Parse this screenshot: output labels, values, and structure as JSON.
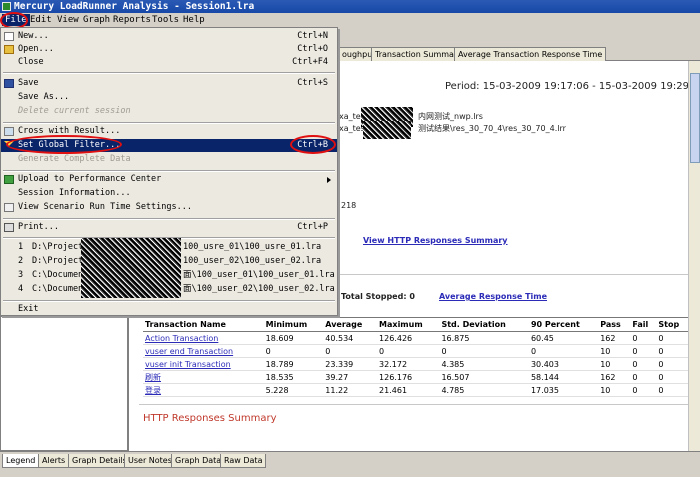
{
  "window": {
    "title": "Mercury LoadRunner Analysis - Session1.lra"
  },
  "menubar": [
    "File",
    "Edit",
    "View",
    "Graph",
    "Reports",
    "Tools",
    "Help"
  ],
  "file_menu": {
    "new": {
      "label": "New...",
      "key": "Ctrl+N"
    },
    "open": {
      "label": "Open...",
      "key": "Ctrl+O"
    },
    "close": {
      "label": "Close",
      "key": "Ctrl+F4"
    },
    "save": {
      "label": "Save",
      "key": "Ctrl+S"
    },
    "save_as": {
      "label": "Save As..."
    },
    "delete_session": {
      "label": "Delete current session"
    },
    "cross_result": {
      "label": "Cross with Result..."
    },
    "set_global_filter": {
      "label": "Set Global Filter...",
      "key": "Ctrl+B"
    },
    "generate_complete_data": {
      "label": "Generate Complete Data"
    },
    "upload": {
      "label": "Upload to Performance Center"
    },
    "session_info": {
      "label": "Session Information..."
    },
    "view_scenario": {
      "label": "View Scenario Run Time Settings..."
    },
    "print": {
      "label": "Print...",
      "key": "Ctrl+P"
    },
    "recent": [
      {
        "n": "1",
        "left": "D:\\Project",
        "right": "100_usre_01\\100_usre_01.lra"
      },
      {
        "n": "2",
        "left": "D:\\Project",
        "right": "100_user_02\\100_user_02.lra"
      },
      {
        "n": "3",
        "left": "C:\\Documents and Settings",
        "right": "面\\100_user_01\\100_user_01.lra"
      },
      {
        "n": "4",
        "left": "C:\\Documents and Settings",
        "right": "面\\100_user_02\\100_user_02.lra"
      }
    ],
    "exit": {
      "label": "Exit"
    }
  },
  "tabs": [
    "oughput",
    "Transaction Summary",
    "Average Transaction Response Time"
  ],
  "summary": {
    "period": "Period: 15-03-2009 19:17:06 - 15-03-2009 19:29:21",
    "file1": "xa_test",
    "file1_tail": "内网测试_nwp.lrs",
    "file2": "xa_test",
    "file2_tail": "测试结果\\res_30_70_4\\res_30_70_4.lrr",
    "number": "218",
    "http_link": "View HTTP Responses Summary",
    "total_stopped": "Total Stopped: 0",
    "avg_link": "Average Response Time",
    "http_section": "HTTP Responses Summary"
  },
  "table": {
    "headers": [
      "Transaction Name",
      "Minimum",
      "Average",
      "Maximum",
      "Std. Deviation",
      "90 Percent",
      "Pass",
      "Fail",
      "Stop"
    ],
    "rows": [
      [
        "Action Transaction",
        "18.609",
        "40.534",
        "126.426",
        "16.875",
        "60.45",
        "162",
        "0",
        "0"
      ],
      [
        "vuser end Transaction",
        "0",
        "0",
        "0",
        "0",
        "0",
        "10",
        "0",
        "0"
      ],
      [
        "vuser init Transaction",
        "18.789",
        "23.339",
        "32.172",
        "4.385",
        "30.403",
        "10",
        "0",
        "0"
      ],
      [
        "刷新",
        "18.535",
        "39.27",
        "126.176",
        "16.507",
        "58.144",
        "162",
        "0",
        "0"
      ],
      [
        "登录",
        "5.228",
        "11.22",
        "21.461",
        "4.785",
        "17.035",
        "10",
        "0",
        "0"
      ]
    ]
  },
  "bottom_tabs": [
    "Legend",
    "Alerts",
    "Graph Details",
    "User Notes",
    "Graph Data",
    "Raw Data"
  ],
  "colors": {
    "highlight": "#0a246a",
    "annotation": "#e01010",
    "link": "#2b2bb8"
  }
}
